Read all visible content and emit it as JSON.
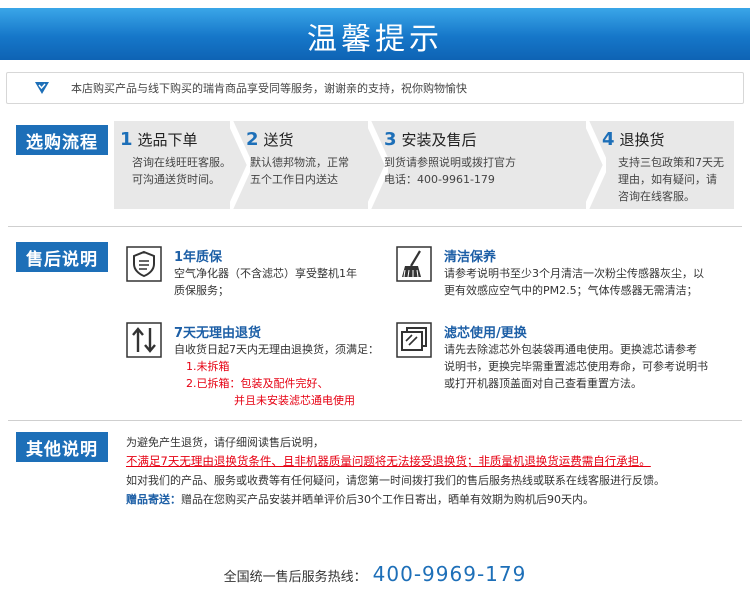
{
  "banner": {
    "title": "温馨提示"
  },
  "notice": {
    "icon": "check-triangle-icon",
    "text": "本店购买产品与线下购买的瑞肯商品享受同等服务，谢谢亲的支持，祝你购物愉快"
  },
  "purchase": {
    "tag": "选购流程",
    "steps": [
      {
        "num": "1",
        "title": "选品下单",
        "desc": [
          "咨询在线旺旺客服。",
          "可沟通送货时间。"
        ]
      },
      {
        "num": "2",
        "title": "送货",
        "desc": [
          "默认德邦物流，正常",
          "五个工作日内送达"
        ]
      },
      {
        "num": "3",
        "title": "安装及售后",
        "desc": [
          "到货请参照说明或拨打官方",
          "电话：400-9961-179"
        ]
      },
      {
        "num": "4",
        "title": "退换货",
        "desc": [
          "支持三包政策和7天无",
          "理由，如有疑问，请",
          "咨询在线客服。"
        ]
      }
    ]
  },
  "aftersale": {
    "tag": "售后说明",
    "warranty": {
      "icon": "shield-icon",
      "title": "1年质保",
      "lines": [
        "空气净化器（不含滤芯）享受整机1年",
        "质保服务；"
      ]
    },
    "cleaning": {
      "icon": "broom-icon",
      "title": "清洁保养",
      "lines": [
        "请参考说明书至少3个月清洁一次粉尘传感器灰尘，以",
        "更有效感应空气中的PM2.5；气体传感器无需清洁；"
      ]
    },
    "returns": {
      "icon": "return-arrows-icon",
      "title": "7天无理由退货",
      "lines": [
        "自收货日起7天内无理由退换货，须满足："
      ],
      "conditions": [
        "1.未拆箱",
        "2.已拆箱：包装及配件完好、",
        "并且未安装滤芯通电使用"
      ]
    },
    "filter": {
      "icon": "filter-icon",
      "title": "滤芯使用/更换",
      "lines": [
        "请先去除滤芯外包装袋再通电使用。更换滤芯请参考",
        "说明书，更换完毕需重置滤芯使用寿命，可参考说明书",
        "或打开机器顶盖面对自己查看重置方法。"
      ]
    }
  },
  "other": {
    "tag": "其他说明",
    "line1": "为避免产生退货，请仔细阅读售后说明，",
    "warning": "不满足7天无理由退换货条件、且非机器质量问题将无法接受退换货；非质量机退换货运费需自行承担。",
    "line3": "如对我们的产品、服务或收费等有任何疑问，请您第一时间拨打我们的售后服务热线或联系在线客服进行反馈。",
    "gift_label": "赠品寄送：",
    "gift_text": "赠品在您购买产品安装并晒单评价后30个工作日寄出，晒单有效期为购机后90天内。"
  },
  "hotline": {
    "label": "全国统一售后服务热线：",
    "number": "400-9969-179"
  },
  "colors": {
    "brand_blue": "#1d6fb8",
    "banner_blue": "#1677c9",
    "warning_red": "#e60012",
    "step_bg": "#e8e8e8"
  }
}
